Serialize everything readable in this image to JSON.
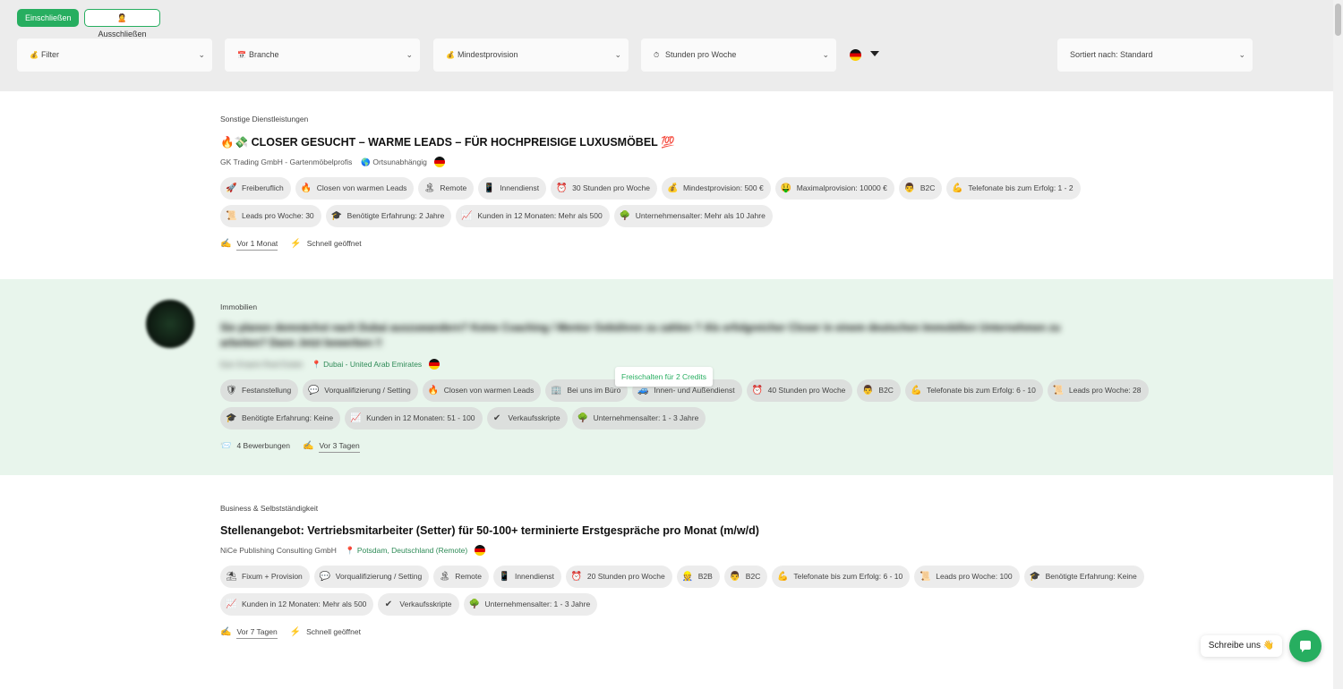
{
  "filters": {
    "include_label": "Einschließen",
    "exclude_label": "Ausschließen",
    "exclude_icon": "🙎",
    "selects": [
      {
        "icon": "💰",
        "label": "Filter"
      },
      {
        "icon": "📅",
        "label": "Branche"
      },
      {
        "icon": "💰",
        "label": "Mindestprovision"
      },
      {
        "icon": "⏱",
        "label": "Stunden pro Woche"
      }
    ],
    "sort_label": "Sortiert nach: Standard",
    "chevron": "⌄"
  },
  "listings": [
    {
      "category": "Sonstige Dienstleistungen",
      "title": "🔥💸 CLOSER GESUCHT – WARME LEADS – FÜR HOCHPREISIGE LUXUSMÖBEL 💯",
      "company": "GK Trading GmbH - Gartenmöbelprofis",
      "location_icon": "🌎",
      "location": "Ortsunabhängig",
      "tags_row1": [
        {
          "icon": "🚀",
          "label": "Freiberuflich"
        },
        {
          "icon": "🔥",
          "label": "Closen von warmen Leads"
        },
        {
          "icon": "🏝",
          "label": "Remote"
        },
        {
          "icon": "📱",
          "label": "Innendienst"
        },
        {
          "icon": "⏰",
          "label": "30 Stunden pro Woche"
        },
        {
          "icon": "💰",
          "label": "Mindestprovision: 500 €"
        },
        {
          "icon": "🤑",
          "label": "Maximalprovision: 10000 €"
        },
        {
          "icon": "👨",
          "label": "B2C"
        },
        {
          "icon": "💪",
          "label": "Telefonate bis zum Erfolg: 1 - 2"
        }
      ],
      "tags_row2": [
        {
          "icon": "📜",
          "label": "Leads pro Woche: 30"
        },
        {
          "icon": "🎓",
          "label": "Benötigte Erfahrung: 2 Jahre"
        },
        {
          "icon": "📈",
          "label": "Kunden in 12 Monaten: Mehr als 500"
        },
        {
          "icon": "🌳",
          "label": "Unternehmensalter: Mehr als 10 Jahre"
        }
      ],
      "footer": [
        {
          "icon": "✍",
          "label": "Vor 1 Monat",
          "underline": true
        },
        {
          "icon": "⚡",
          "label": "Schnell geöffnet",
          "underline": false
        }
      ]
    },
    {
      "category": "Immobilien",
      "title_line1": "Sie planen demnächst nach Dubai auszuwandern? Keine Coaching / Mentor Gebühren zu zahlen ? Als erfolgreicher Closer in einem deutschen Immobilien Unternehmen zu",
      "title_line2": "arbeiten? Dann Jetzt bewerben !!",
      "company": "Epic Empire Real Estate",
      "location_icon": "📍",
      "location": "Dubai - United Arab Emirates",
      "unlock_label": "Freischalten für 2 Credits",
      "tags_row1": [
        {
          "icon": "🛡",
          "label": "Festanstellung"
        },
        {
          "icon": "💬",
          "label": "Vorqualifizierung / Setting"
        },
        {
          "icon": "🔥",
          "label": "Closen von warmen Leads"
        },
        {
          "icon": "🏢",
          "label": "Bei uns im Büro"
        },
        {
          "icon": "🚙",
          "label": "Innen- und Außendienst"
        },
        {
          "icon": "⏰",
          "label": "40 Stunden pro Woche"
        },
        {
          "icon": "👨",
          "label": "B2C"
        },
        {
          "icon": "💪",
          "label": "Telefonate bis zum Erfolg: 6 - 10"
        },
        {
          "icon": "📜",
          "label": "Leads pro Woche: 28"
        }
      ],
      "tags_row2": [
        {
          "icon": "🎓",
          "label": "Benötigte Erfahrung: Keine"
        },
        {
          "icon": "📈",
          "label": "Kunden in 12 Monaten: 51 - 100"
        },
        {
          "icon": "✔",
          "label": "Verkaufsskripte"
        },
        {
          "icon": "🌳",
          "label": "Unternehmensalter: 1 - 3 Jahre"
        }
      ],
      "footer": [
        {
          "icon": "📨",
          "label": "4 Bewerbungen",
          "underline": false
        },
        {
          "icon": "✍",
          "label": "Vor 3 Tagen",
          "underline": true
        }
      ]
    },
    {
      "category": "Business & Selbstständigkeit",
      "title": "Stellenangebot: Vertriebsmitarbeiter (Setter) für 50-100+ terminierte Erstgespräche pro Monat (m/w/d)",
      "company": "NiCe Publishing Consulting GmbH",
      "location_icon": "📍",
      "location": "Potsdam, Deutschland (Remote)",
      "tags_row1": [
        {
          "icon": "⛱",
          "label": "Fixum + Provision"
        },
        {
          "icon": "💬",
          "label": "Vorqualifizierung / Setting"
        },
        {
          "icon": "🏝",
          "label": "Remote"
        },
        {
          "icon": "📱",
          "label": "Innendienst"
        },
        {
          "icon": "⏰",
          "label": "20 Stunden pro Woche"
        },
        {
          "icon": "👷",
          "label": "B2B"
        },
        {
          "icon": "👨",
          "label": "B2C"
        },
        {
          "icon": "💪",
          "label": "Telefonate bis zum Erfolg: 6 - 10"
        },
        {
          "icon": "📜",
          "label": "Leads pro Woche: 100"
        },
        {
          "icon": "🎓",
          "label": "Benötigte Erfahrung: Keine"
        }
      ],
      "tags_row2": [
        {
          "icon": "📈",
          "label": "Kunden in 12 Monaten: Mehr als 500"
        },
        {
          "icon": "✔",
          "label": "Verkaufsskripte"
        },
        {
          "icon": "🌳",
          "label": "Unternehmensalter: 1 - 3 Jahre"
        }
      ],
      "footer": [
        {
          "icon": "✍",
          "label": "Vor 7 Tagen",
          "underline": true
        },
        {
          "icon": "⚡",
          "label": "Schnell geöffnet",
          "underline": false
        }
      ]
    }
  ],
  "chat": {
    "bubble_label": "Schreibe uns 👋"
  },
  "colors": {
    "accent": "#27ae60",
    "highlight_row": "#e8f5ec"
  }
}
